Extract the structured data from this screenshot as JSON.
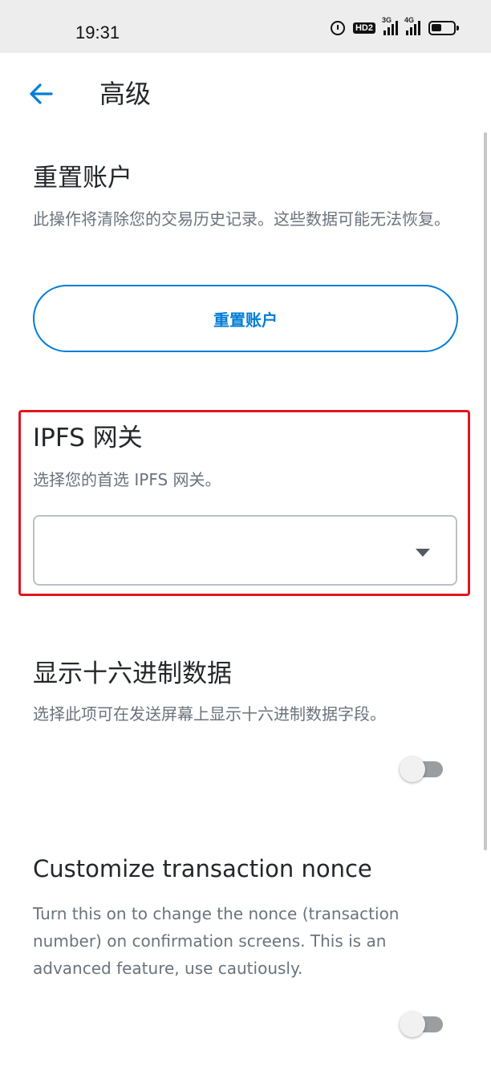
{
  "status_bar": {
    "time": "19:31",
    "icons": [
      "alarm-icon",
      "hd-icon",
      "signal-3g-icon",
      "signal-4g-icon",
      "battery-icon"
    ],
    "hd_label": "HD2",
    "signal1_label": "3G",
    "signal2_label": "4G"
  },
  "header": {
    "back_icon": "arrow-left-icon",
    "title": "高级"
  },
  "reset_account": {
    "title": "重置账户",
    "description": "此操作将清除您的交易历史记录。这些数据可能无法恢复。",
    "button_label": "重置账户"
  },
  "ipfs_gateway": {
    "title": "IPFS 网关",
    "description": "选择您的首选 IPFS 网关。",
    "selected_value": ""
  },
  "show_hex_data": {
    "title": "显示十六进制数据",
    "description": "选择此项可在发送屏幕上显示十六进制数据字段。",
    "enabled": false
  },
  "customize_nonce": {
    "title": "Customize transaction nonce",
    "description": "Turn this on to change the nonce (transaction number) on confirmation screens. This is an advanced feature, use cautiously.",
    "enabled": false
  },
  "colors": {
    "accent": "#037dd6",
    "highlight": "#e0161c",
    "text": "#24272a",
    "muted": "#6a737d"
  }
}
